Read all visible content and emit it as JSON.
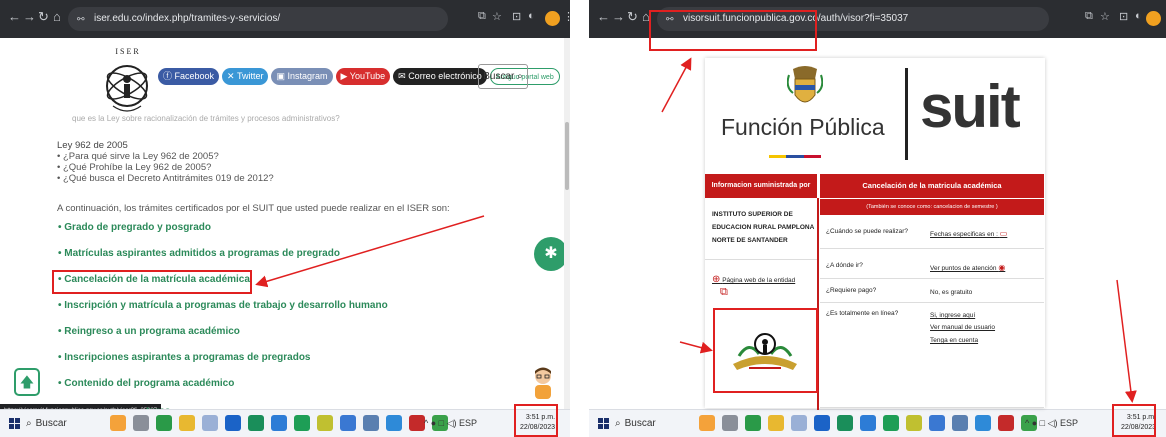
{
  "left": {
    "url": "iser.edu.co/index.php/tramites-y-servicios/",
    "socials": [
      {
        "label": "Facebook",
        "color": "#3b5ba4"
      },
      {
        "label": "Twitter",
        "color": "#3a97d6"
      },
      {
        "label": "Instagram",
        "color": "#7a8fb6"
      },
      {
        "label": "YouTube",
        "color": "#d72e2e"
      },
      {
        "label": "Correo electrónico",
        "color": "#222222"
      }
    ],
    "portal_label": "Antiguo portal web",
    "search_label": "Buscar",
    "faded_text": "que es la Ley sobre racionalización de trámites y procesos administrativos?",
    "law_title": "Ley 962 de 2005",
    "law_items": [
      "¿Para qué sirve la Ley 962 de 2005?",
      "¿Qué Prohíbe la Ley 962 de 2005?",
      "¿Qué busca el Decreto Antitrámites 019 de 2012?"
    ],
    "intro": "A continuación, los trámites certificados por el SUIT que usted puede realizar en el ISER son:",
    "tramites": [
      "Grado de pregrado y posgrado",
      "Matrículas aspirantes admitidos a programas de pregrado",
      "Cancelación de la matrícula académica",
      "Inscripción y matrícula a programas de trabajo y desarrollo humano",
      "Reingreso a un programa académico",
      "Inscripciones aspirantes a programas de pregrados",
      "Contenido del programa académico"
    ],
    "status_url": "https://visorsuit.funcionpublica.gov.co/auth/visor?fi=35037",
    "cut_text": "turas",
    "taskbar_search": "Buscar",
    "tray": "^ ● □ ◁) ESP",
    "clock_time": "3:51 p.m.",
    "clock_date": "22/08/2023"
  },
  "right": {
    "url": "visorsuit.funcionpublica.gov.co/auth/visor?fi=35037",
    "brand_fp": "Función Pública",
    "brand_suit": "suit",
    "left_header": "Informacion suministrada por",
    "right_header": "Cancelación de la matricula académica",
    "right_sub": "(También se conoce como: cancelacion de semestre )",
    "institution": "INSTITUTO SUPERIOR DE EDUCACION RURAL PAMPLONA NORTE DE SANTANDER",
    "web_link": "Página web de la entidad",
    "questions": [
      {
        "q": "¿Cuándo se puede realizar?",
        "a": "Fechas especificas en :"
      },
      {
        "q": "¿A dónde ir?",
        "a": "Ver puntos de atención"
      },
      {
        "q": "¿Requiere pago?",
        "a": "No, es gratuito"
      },
      {
        "q": "¿Es totalmente en línea?",
        "a": "Si, ingrese aquí"
      }
    ],
    "extra_links": [
      "Ver manual de usuario",
      "Tenga en cuenta"
    ],
    "taskbar_search": "Buscar",
    "tray": "^ ● □ ◁) ESP",
    "clock_time": "3:51 p.m.",
    "clock_date": "22/08/2023"
  },
  "colors": {
    "accent_red": "#c31a1a",
    "iser_green": "#2c8a5a",
    "annotation_red": "#e02020"
  }
}
